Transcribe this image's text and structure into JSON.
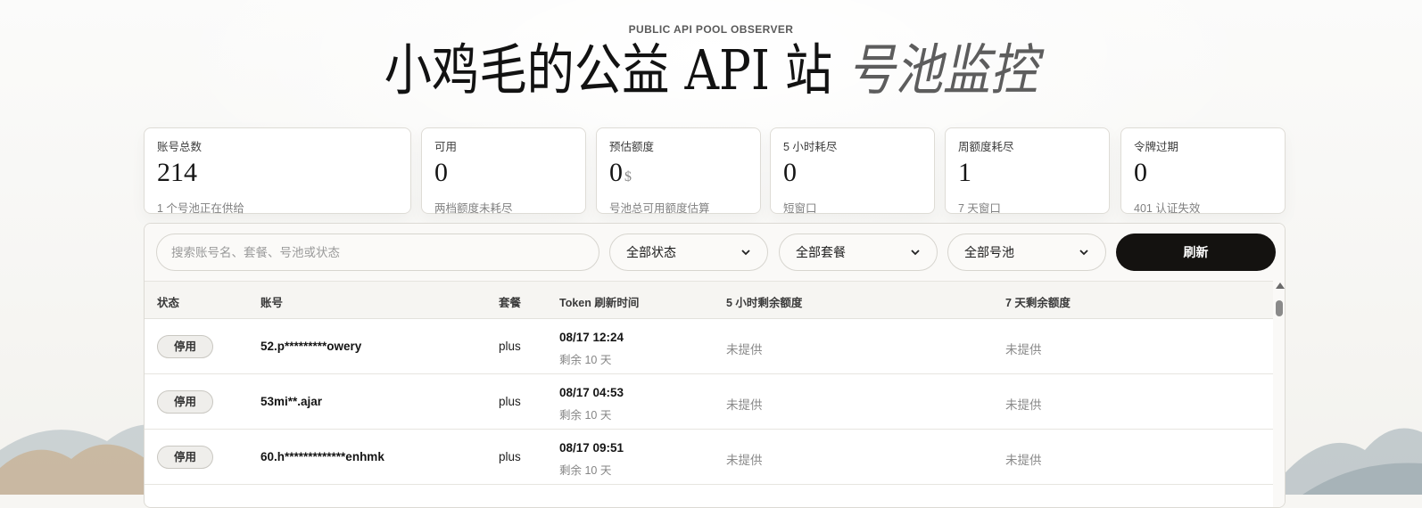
{
  "header": {
    "eyebrow": "PUBLIC API POOL OBSERVER",
    "title_main": "小鸡毛的公益 API 站",
    "title_accent": "号池监控"
  },
  "stats": [
    {
      "label": "账号总数",
      "value": "214",
      "unit": "",
      "desc": "1 个号池正在供给"
    },
    {
      "label": "可用",
      "value": "0",
      "unit": "",
      "desc": "两档额度未耗尽"
    },
    {
      "label": "预估额度",
      "value": "0",
      "unit": "$",
      "desc": "号池总可用额度估算"
    },
    {
      "label": "5 小时耗尽",
      "value": "0",
      "unit": "",
      "desc": "短窗口"
    },
    {
      "label": "周额度耗尽",
      "value": "1",
      "unit": "",
      "desc": "7 天窗口"
    },
    {
      "label": "令牌过期",
      "value": "0",
      "unit": "",
      "desc": "401 认证失效"
    }
  ],
  "toolbar": {
    "search_placeholder": "搜索账号名、套餐、号池或状态",
    "status_filter": "全部状态",
    "plan_filter": "全部套餐",
    "pool_filter": "全部号池",
    "refresh_label": "刷新"
  },
  "table": {
    "headers": [
      "状态",
      "账号",
      "套餐",
      "Token 刷新时间",
      "5 小时剩余额度",
      "7 天剩余额度"
    ],
    "rows": [
      {
        "status": "停用",
        "account": "52.p*********owery",
        "plan": "plus",
        "token_time": "08/17 12:24",
        "token_remaining": "剩余 10 天",
        "quota_5h": "未提供",
        "quota_7d": "未提供"
      },
      {
        "status": "停用",
        "account": "53mi**.ajar",
        "plan": "plus",
        "token_time": "08/17 04:53",
        "token_remaining": "剩余 10 天",
        "quota_5h": "未提供",
        "quota_7d": "未提供"
      },
      {
        "status": "停用",
        "account": "60.h*************enhmk",
        "plan": "plus",
        "token_time": "08/17 09:51",
        "token_remaining": "剩余 10 天",
        "quota_5h": "未提供",
        "quota_7d": "未提供"
      }
    ]
  },
  "icons": {
    "select_chevron": "chevron-down-icon",
    "scroll_up": "triangle-up-icon"
  },
  "colors": {
    "accent_button": "#141210",
    "title_accent": "#5d5d5d"
  }
}
